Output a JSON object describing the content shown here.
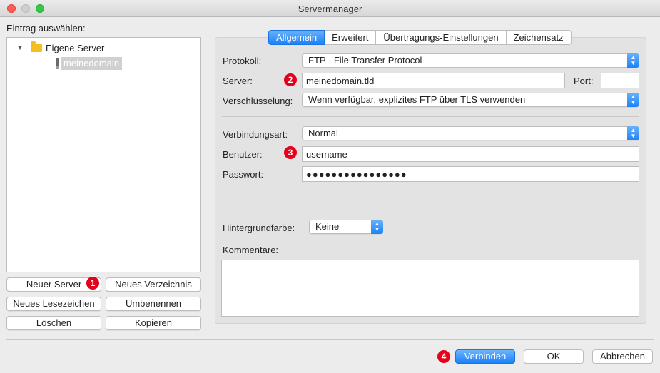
{
  "window": {
    "title": "Servermanager"
  },
  "sidebar": {
    "heading": "Eintrag auswählen:",
    "tree": {
      "folder": "Eigene Server",
      "selected_item": "meinedomain"
    },
    "buttons": {
      "new_server": "Neuer Server",
      "new_folder": "Neues Verzeichnis",
      "new_bookmark": "Neues Lesezeichen",
      "rename": "Umbenennen",
      "delete": "Löschen",
      "copy": "Kopieren"
    }
  },
  "tabs": [
    {
      "label": "Allgemein",
      "active": true
    },
    {
      "label": "Erweitert",
      "active": false
    },
    {
      "label": "Übertragungs-Einstellungen",
      "active": false
    },
    {
      "label": "Zeichensatz",
      "active": false
    }
  ],
  "form": {
    "protocol": {
      "label": "Protokoll:",
      "value": "FTP - File Transfer Protocol"
    },
    "server": {
      "label": "Server:",
      "value": "meinedomain.tld"
    },
    "port": {
      "label": "Port:",
      "value": ""
    },
    "encryption": {
      "label": "Verschlüsselung:",
      "value": "Wenn verfügbar, explizites FTP über TLS verwenden"
    },
    "logon_type": {
      "label": "Verbindungsart:",
      "value": "Normal"
    },
    "user": {
      "label": "Benutzer:",
      "value": "username"
    },
    "password": {
      "label": "Passwort:",
      "value": "●●●●●●●●●●●●●●●●"
    },
    "background_color": {
      "label": "Hintergrundfarbe:",
      "value": "Keine"
    },
    "comments": {
      "label": "Kommentare:",
      "value": ""
    }
  },
  "badges": [
    "1",
    "2",
    "3",
    "4"
  ],
  "footer": {
    "connect": "Verbinden",
    "ok": "OK",
    "cancel": "Abbrechen"
  },
  "colors": {
    "accent": "#1a82fb",
    "badge": "#e5001b",
    "window_bg": "#ececec"
  }
}
